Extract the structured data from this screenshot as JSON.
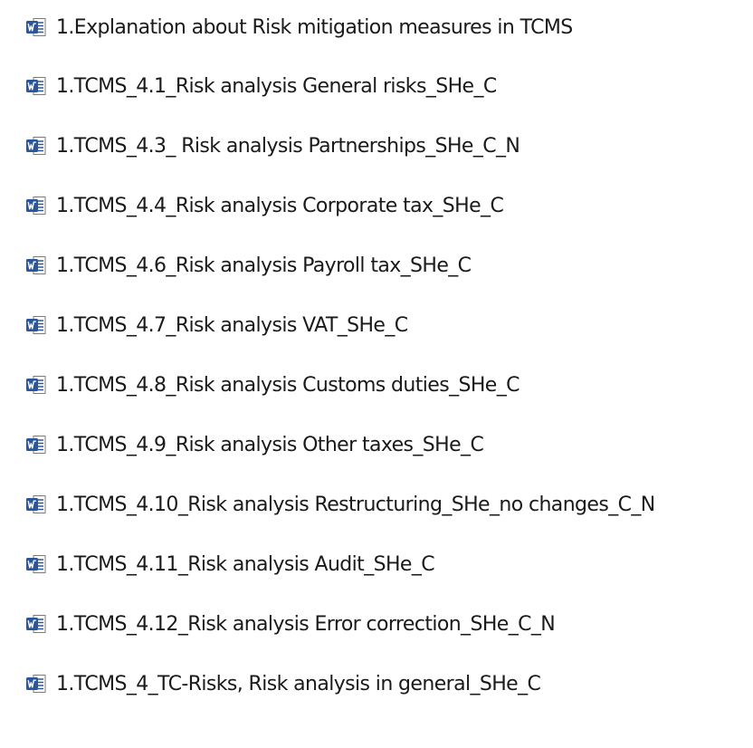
{
  "files": [
    {
      "name": "1.Explanation about Risk mitigation measures in TCMS",
      "icon": "word-document-icon"
    },
    {
      "name": "1.TCMS_4.1_Risk analysis General risks_SHe_C",
      "icon": "word-document-icon"
    },
    {
      "name": "1.TCMS_4.3_ Risk analysis Partnerships_SHe_C_N",
      "icon": "word-document-icon"
    },
    {
      "name": "1.TCMS_4.4_Risk analysis Corporate tax_SHe_C",
      "icon": "word-document-icon"
    },
    {
      "name": "1.TCMS_4.6_Risk analysis Payroll tax_SHe_C",
      "icon": "word-document-icon"
    },
    {
      "name": "1.TCMS_4.7_Risk analysis VAT_SHe_C",
      "icon": "word-document-icon"
    },
    {
      "name": "1.TCMS_4.8_Risk analysis Customs duties_SHe_C",
      "icon": "word-document-icon"
    },
    {
      "name": "1.TCMS_4.9_Risk analysis Other taxes_SHe_C",
      "icon": "word-document-icon"
    },
    {
      "name": "1.TCMS_4.10_Risk analysis Restructuring_SHe_no changes_C_N",
      "icon": "word-document-icon"
    },
    {
      "name": "1.TCMS_4.11_Risk analysis Audit_SHe_C",
      "icon": "word-document-icon"
    },
    {
      "name": "1.TCMS_4.12_Risk analysis Error correction_SHe_C_N",
      "icon": "word-document-icon"
    },
    {
      "name": "1.TCMS_4_TC-Risks, Risk analysis in general_SHe_C",
      "icon": "word-document-icon"
    }
  ],
  "colors": {
    "icon_blue": "#2b579a",
    "icon_page": "#ffffff",
    "icon_border": "#7a7a7a",
    "text": "#1a1a1a"
  }
}
